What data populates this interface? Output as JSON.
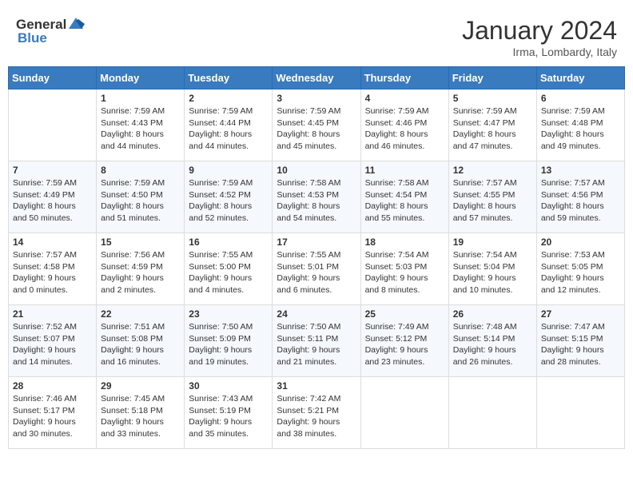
{
  "header": {
    "logo_general": "General",
    "logo_blue": "Blue",
    "month": "January 2024",
    "location": "Irma, Lombardy, Italy"
  },
  "weekdays": [
    "Sunday",
    "Monday",
    "Tuesday",
    "Wednesday",
    "Thursday",
    "Friday",
    "Saturday"
  ],
  "weeks": [
    [
      {
        "day": "",
        "sunrise": "",
        "sunset": "",
        "daylight": ""
      },
      {
        "day": "1",
        "sunrise": "Sunrise: 7:59 AM",
        "sunset": "Sunset: 4:43 PM",
        "daylight": "Daylight: 8 hours and 44 minutes."
      },
      {
        "day": "2",
        "sunrise": "Sunrise: 7:59 AM",
        "sunset": "Sunset: 4:44 PM",
        "daylight": "Daylight: 8 hours and 44 minutes."
      },
      {
        "day": "3",
        "sunrise": "Sunrise: 7:59 AM",
        "sunset": "Sunset: 4:45 PM",
        "daylight": "Daylight: 8 hours and 45 minutes."
      },
      {
        "day": "4",
        "sunrise": "Sunrise: 7:59 AM",
        "sunset": "Sunset: 4:46 PM",
        "daylight": "Daylight: 8 hours and 46 minutes."
      },
      {
        "day": "5",
        "sunrise": "Sunrise: 7:59 AM",
        "sunset": "Sunset: 4:47 PM",
        "daylight": "Daylight: 8 hours and 47 minutes."
      },
      {
        "day": "6",
        "sunrise": "Sunrise: 7:59 AM",
        "sunset": "Sunset: 4:48 PM",
        "daylight": "Daylight: 8 hours and 49 minutes."
      }
    ],
    [
      {
        "day": "7",
        "sunrise": "Sunrise: 7:59 AM",
        "sunset": "Sunset: 4:49 PM",
        "daylight": "Daylight: 8 hours and 50 minutes."
      },
      {
        "day": "8",
        "sunrise": "Sunrise: 7:59 AM",
        "sunset": "Sunset: 4:50 PM",
        "daylight": "Daylight: 8 hours and 51 minutes."
      },
      {
        "day": "9",
        "sunrise": "Sunrise: 7:59 AM",
        "sunset": "Sunset: 4:52 PM",
        "daylight": "Daylight: 8 hours and 52 minutes."
      },
      {
        "day": "10",
        "sunrise": "Sunrise: 7:58 AM",
        "sunset": "Sunset: 4:53 PM",
        "daylight": "Daylight: 8 hours and 54 minutes."
      },
      {
        "day": "11",
        "sunrise": "Sunrise: 7:58 AM",
        "sunset": "Sunset: 4:54 PM",
        "daylight": "Daylight: 8 hours and 55 minutes."
      },
      {
        "day": "12",
        "sunrise": "Sunrise: 7:57 AM",
        "sunset": "Sunset: 4:55 PM",
        "daylight": "Daylight: 8 hours and 57 minutes."
      },
      {
        "day": "13",
        "sunrise": "Sunrise: 7:57 AM",
        "sunset": "Sunset: 4:56 PM",
        "daylight": "Daylight: 8 hours and 59 minutes."
      }
    ],
    [
      {
        "day": "14",
        "sunrise": "Sunrise: 7:57 AM",
        "sunset": "Sunset: 4:58 PM",
        "daylight": "Daylight: 9 hours and 0 minutes."
      },
      {
        "day": "15",
        "sunrise": "Sunrise: 7:56 AM",
        "sunset": "Sunset: 4:59 PM",
        "daylight": "Daylight: 9 hours and 2 minutes."
      },
      {
        "day": "16",
        "sunrise": "Sunrise: 7:55 AM",
        "sunset": "Sunset: 5:00 PM",
        "daylight": "Daylight: 9 hours and 4 minutes."
      },
      {
        "day": "17",
        "sunrise": "Sunrise: 7:55 AM",
        "sunset": "Sunset: 5:01 PM",
        "daylight": "Daylight: 9 hours and 6 minutes."
      },
      {
        "day": "18",
        "sunrise": "Sunrise: 7:54 AM",
        "sunset": "Sunset: 5:03 PM",
        "daylight": "Daylight: 9 hours and 8 minutes."
      },
      {
        "day": "19",
        "sunrise": "Sunrise: 7:54 AM",
        "sunset": "Sunset: 5:04 PM",
        "daylight": "Daylight: 9 hours and 10 minutes."
      },
      {
        "day": "20",
        "sunrise": "Sunrise: 7:53 AM",
        "sunset": "Sunset: 5:05 PM",
        "daylight": "Daylight: 9 hours and 12 minutes."
      }
    ],
    [
      {
        "day": "21",
        "sunrise": "Sunrise: 7:52 AM",
        "sunset": "Sunset: 5:07 PM",
        "daylight": "Daylight: 9 hours and 14 minutes."
      },
      {
        "day": "22",
        "sunrise": "Sunrise: 7:51 AM",
        "sunset": "Sunset: 5:08 PM",
        "daylight": "Daylight: 9 hours and 16 minutes."
      },
      {
        "day": "23",
        "sunrise": "Sunrise: 7:50 AM",
        "sunset": "Sunset: 5:09 PM",
        "daylight": "Daylight: 9 hours and 19 minutes."
      },
      {
        "day": "24",
        "sunrise": "Sunrise: 7:50 AM",
        "sunset": "Sunset: 5:11 PM",
        "daylight": "Daylight: 9 hours and 21 minutes."
      },
      {
        "day": "25",
        "sunrise": "Sunrise: 7:49 AM",
        "sunset": "Sunset: 5:12 PM",
        "daylight": "Daylight: 9 hours and 23 minutes."
      },
      {
        "day": "26",
        "sunrise": "Sunrise: 7:48 AM",
        "sunset": "Sunset: 5:14 PM",
        "daylight": "Daylight: 9 hours and 26 minutes."
      },
      {
        "day": "27",
        "sunrise": "Sunrise: 7:47 AM",
        "sunset": "Sunset: 5:15 PM",
        "daylight": "Daylight: 9 hours and 28 minutes."
      }
    ],
    [
      {
        "day": "28",
        "sunrise": "Sunrise: 7:46 AM",
        "sunset": "Sunset: 5:17 PM",
        "daylight": "Daylight: 9 hours and 30 minutes."
      },
      {
        "day": "29",
        "sunrise": "Sunrise: 7:45 AM",
        "sunset": "Sunset: 5:18 PM",
        "daylight": "Daylight: 9 hours and 33 minutes."
      },
      {
        "day": "30",
        "sunrise": "Sunrise: 7:43 AM",
        "sunset": "Sunset: 5:19 PM",
        "daylight": "Daylight: 9 hours and 35 minutes."
      },
      {
        "day": "31",
        "sunrise": "Sunrise: 7:42 AM",
        "sunset": "Sunset: 5:21 PM",
        "daylight": "Daylight: 9 hours and 38 minutes."
      },
      {
        "day": "",
        "sunrise": "",
        "sunset": "",
        "daylight": ""
      },
      {
        "day": "",
        "sunrise": "",
        "sunset": "",
        "daylight": ""
      },
      {
        "day": "",
        "sunrise": "",
        "sunset": "",
        "daylight": ""
      }
    ]
  ]
}
